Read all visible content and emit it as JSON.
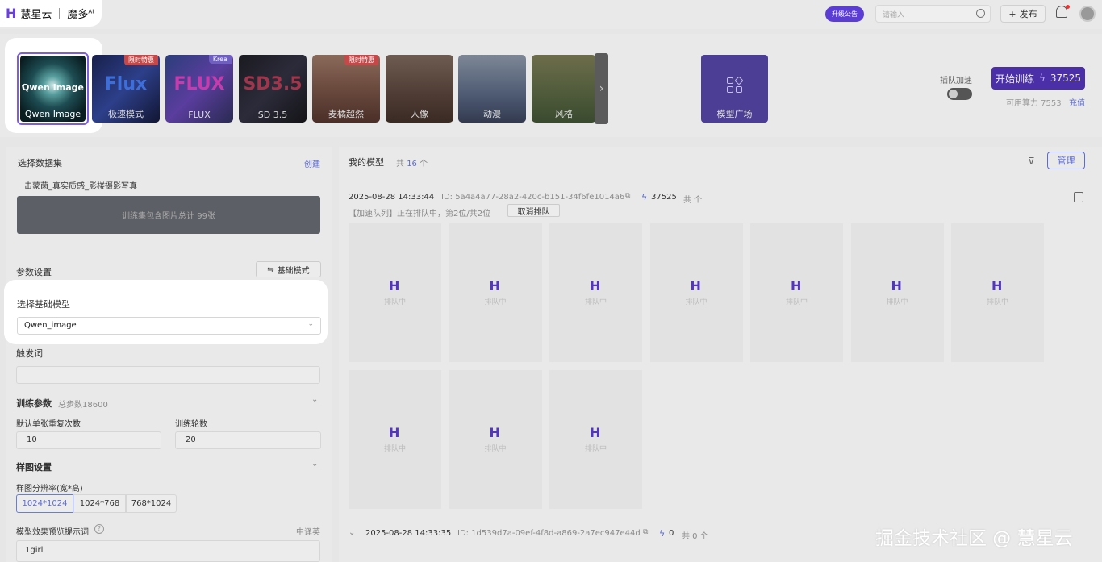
{
  "topbar": {
    "logo_mark": "H",
    "brand": "慧星云",
    "product": "魔多",
    "product_sup": "AI",
    "notice_label": "升级公告",
    "search_placeholder": "请输入",
    "publish_label": "发布"
  },
  "models": [
    {
      "label": "Qwen Image",
      "title": "Qwen Image",
      "badge": "",
      "selected": true
    },
    {
      "label": "极速模式",
      "title": "Flux",
      "badge": "限时特惠"
    },
    {
      "label": "FLUX",
      "title": "FLUX",
      "badge": "Krea"
    },
    {
      "label": "SD 3.5",
      "title": "SD3.5",
      "badge": ""
    },
    {
      "label": "麦橘超然",
      "title": "",
      "badge": "限时特惠"
    },
    {
      "label": "人像",
      "title": "",
      "badge": ""
    },
    {
      "label": "动漫",
      "title": "",
      "badge": ""
    },
    {
      "label": "风格",
      "title": "",
      "badge": ""
    }
  ],
  "model_square_label": "模型广场",
  "queue_accel_label": "插队加速",
  "start_train_label": "开始训练",
  "start_train_cost": "37525",
  "available_power": "可用算力 7553",
  "recharge_label": "充值",
  "dataset": {
    "title": "选择数据集",
    "create_label": "创建",
    "name": "击蒙菌_真实质感_影楼摄影写真",
    "summary": "训练集包含图片总计 99张"
  },
  "params": {
    "title": "参数设置",
    "basic_mode_label": "基础模式",
    "base_model_label": "选择基础模型",
    "base_model_value": "Qwen_image",
    "trigger_label": "触发词",
    "train_params_label": "训练参数",
    "total_steps": "总步数18600",
    "repeat_label": "默认单张重复次数",
    "repeat_value": "10",
    "epochs_label": "训练轮数",
    "epochs_value": "20",
    "sample_label": "样图设置",
    "resolution_label": "样图分辨率(宽*高)",
    "resolutions": [
      "1024*1024",
      "1024*768",
      "768*1024"
    ],
    "prompt_label": "模型效果预览提示词",
    "lang_label": "中译英",
    "prompt_value": "1girl"
  },
  "my_models": {
    "title": "我的模型",
    "count_prefix": "共",
    "count": "16",
    "count_suffix": "个",
    "manage_label": "管理",
    "job1": {
      "time": "2025-08-28 14:33:44",
      "id": "ID: 5a4a4a77-28a2-420c-b151-34f6fe1014a6",
      "cost": "37525",
      "total": "共 个",
      "status": "【加速队列】正在排队中，第2位/共2位",
      "cancel_label": "取消排队"
    },
    "placeholder_text": "排队中",
    "job2": {
      "time": "2025-08-28 14:33:35",
      "id": "ID: 1d539d7a-09ef-4f8d-a869-2a7ec947e44d",
      "cost": "0",
      "total": "共 0 个"
    }
  },
  "watermark": "掘金技术社区 @ 慧星云"
}
